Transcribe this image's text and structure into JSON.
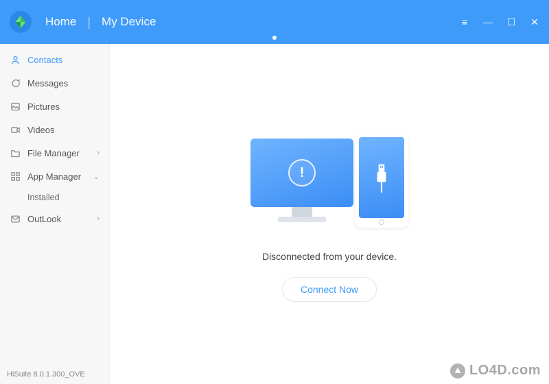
{
  "header": {
    "home_label": "Home",
    "device_label": "My Device",
    "active_tab": "Home"
  },
  "window_controls": {
    "menu": "≡",
    "minimize": "—",
    "maximize": "☐",
    "close": "✕"
  },
  "sidebar": {
    "items": [
      {
        "id": "contacts",
        "label": "Contacts",
        "icon": "person",
        "active": true
      },
      {
        "id": "messages",
        "label": "Messages",
        "icon": "chat"
      },
      {
        "id": "pictures",
        "label": "Pictures",
        "icon": "image"
      },
      {
        "id": "videos",
        "label": "Videos",
        "icon": "video"
      },
      {
        "id": "filemgr",
        "label": "File Manager",
        "icon": "folder",
        "expandable": true,
        "expanded": false
      },
      {
        "id": "appmgr",
        "label": "App Manager",
        "icon": "apps",
        "expandable": true,
        "expanded": true,
        "children": [
          {
            "id": "installed",
            "label": "Installed"
          }
        ]
      },
      {
        "id": "outlook",
        "label": "OutLook",
        "icon": "mail",
        "expandable": true,
        "expanded": false
      }
    ]
  },
  "main": {
    "status_text": "Disconnected from your device.",
    "connect_button": "Connect Now"
  },
  "footer": {
    "version": "HiSuite 8.0.1.300_OVE"
  },
  "watermark": {
    "text": "LO4D.com"
  },
  "colors": {
    "accent": "#3e9bfa",
    "sidebar_bg": "#f7f7f7"
  }
}
